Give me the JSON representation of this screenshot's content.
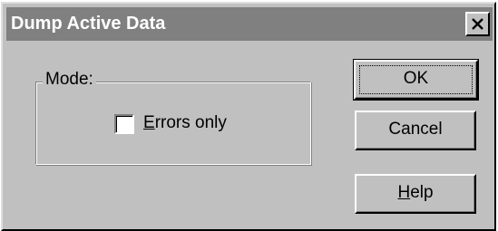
{
  "dialog": {
    "title": "Dump Active Data",
    "close_glyph": "×"
  },
  "mode_group": {
    "label": "Mode:",
    "checkbox": {
      "label_mnemonic": "E",
      "label_rest": "rrors only",
      "checked": false
    }
  },
  "buttons": {
    "ok": "OK",
    "cancel": "Cancel",
    "help_mnemonic": "H",
    "help_rest": "elp"
  },
  "icons": {
    "close": "close-icon"
  }
}
